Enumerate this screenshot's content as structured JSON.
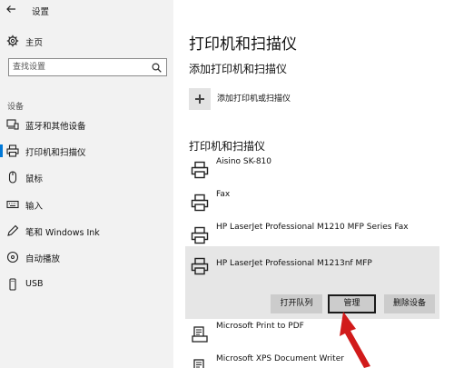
{
  "window": {
    "title": "设置",
    "back_icon": "back-arrow-icon"
  },
  "sidebar": {
    "home": {
      "label": "主页",
      "icon": "gear-icon"
    },
    "search": {
      "placeholder": "查找设置",
      "icon": "search-icon"
    },
    "section": "设备",
    "items": [
      {
        "label": "蓝牙和其他设备",
        "icon": "bluetooth-devices-icon"
      },
      {
        "label": "打印机和扫描仪",
        "icon": "printer-icon",
        "active": true
      },
      {
        "label": "鼠标",
        "icon": "mouse-icon"
      },
      {
        "label": "输入",
        "icon": "keyboard-icon"
      },
      {
        "label": "笔和 Windows Ink",
        "icon": "pen-icon"
      },
      {
        "label": "自动播放",
        "icon": "autoplay-icon"
      },
      {
        "label": "USB",
        "icon": "usb-icon"
      }
    ]
  },
  "main": {
    "title": "打印机和扫描仪",
    "add_section": {
      "heading": "添加打印机和扫描仪",
      "button_label": "添加打印机或扫描仪"
    },
    "list_heading": "打印机和扫描仪",
    "devices": [
      {
        "name": "Aisino SK-810",
        "icon": "printer-icon"
      },
      {
        "name": "Fax",
        "icon": "printer-icon"
      },
      {
        "name": "HP LaserJet Professional M1210 MFP Series Fax",
        "icon": "printer-icon"
      },
      {
        "name": "HP LaserJet Professional M1213nf MFP",
        "icon": "printer-icon",
        "selected": true
      },
      {
        "name": "Microsoft Print to PDF",
        "icon": "document-printer-icon"
      },
      {
        "name": "Microsoft XPS Document Writer",
        "icon": "document-printer-icon"
      }
    ],
    "actions": [
      {
        "label": "打开队列"
      },
      {
        "label": "管理",
        "focused": true
      },
      {
        "label": "删除设备"
      }
    ]
  },
  "colors": {
    "accent": "#0078d7",
    "annotation_arrow": "#d11a1a",
    "sidebar_bg": "#f2f2f2",
    "selected_bg": "#e6e6e6"
  }
}
